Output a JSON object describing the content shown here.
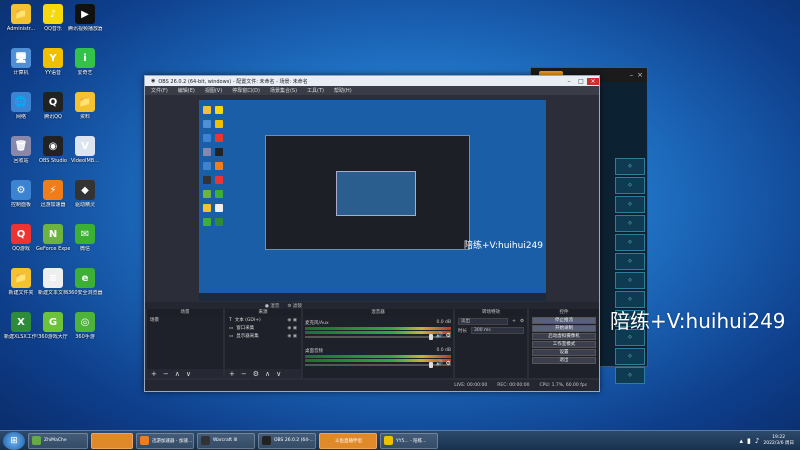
{
  "desktop_icons": [
    {
      "label": "Administr...",
      "color": "#f2c230",
      "glyph": "📁"
    },
    {
      "label": "QQ音乐",
      "color": "#f5d90a",
      "glyph": "♪"
    },
    {
      "label": "腾讯视频播放器",
      "color": "#111",
      "glyph": "▶"
    },
    {
      "label": "计算机",
      "color": "#4f8fd6",
      "glyph": "🖥"
    },
    {
      "label": "YY语音",
      "color": "#f0c000",
      "glyph": "Y"
    },
    {
      "label": "爱奇艺",
      "color": "#33c24a",
      "glyph": "i"
    },
    {
      "label": "网络",
      "color": "#3c83d2",
      "glyph": "🌐"
    },
    {
      "label": "腾讯QQ",
      "color": "#222",
      "glyph": "Q"
    },
    {
      "label": "资料",
      "color": "#f2c230",
      "glyph": "📁"
    },
    {
      "label": "回收站",
      "color": "#88a",
      "glyph": "🗑"
    },
    {
      "label": "OBS Studio",
      "color": "#222",
      "glyph": "◉"
    },
    {
      "label": "VideoIMB...",
      "color": "#dce4ef",
      "glyph": "V"
    },
    {
      "label": "控制面板",
      "color": "#3c83d2",
      "glyph": "⚙"
    },
    {
      "label": "迅游加速器",
      "color": "#f07c1a",
      "glyph": "⚡"
    },
    {
      "label": "驱动精灵",
      "color": "#333",
      "glyph": "◆"
    },
    {
      "label": "QQ游戏",
      "color": "#e33",
      "glyph": "Q"
    },
    {
      "label": "GeForce Experience",
      "color": "#6db33f",
      "glyph": "N"
    },
    {
      "label": "微信",
      "color": "#3cb034",
      "glyph": "✉"
    },
    {
      "label": "新建文件夹",
      "color": "#f2c230",
      "glyph": "📁"
    },
    {
      "label": "新建文本文档",
      "color": "#eee",
      "glyph": "≡"
    },
    {
      "label": "360安全浏览器",
      "color": "#3cb034",
      "glyph": "e"
    },
    {
      "label": "新建XLSX工作表",
      "color": "#2e8b3c",
      "glyph": "X"
    },
    {
      "label": "360游戏大厅",
      "color": "#6cc23a",
      "glyph": "G"
    },
    {
      "label": "360手游",
      "color": "#4db33a",
      "glyph": "◎"
    }
  ],
  "obs": {
    "title": "OBS 26.0.2 (64-bit, windows) - 配置文件: 未命名 - 场景: 未命名",
    "menu": [
      "文件(F)",
      "编辑(E)",
      "视图(V)",
      "停靠窗口(D)",
      "场景集合(S)",
      "工具(T)",
      "帮助(H)"
    ],
    "preview_watermark": "陪练+V:huihui249",
    "scene_bar": [
      "● 混音",
      "⚙ 滤镜"
    ],
    "docks": {
      "scenes_title": "场景",
      "sources_title": "来源",
      "mixer_title": "混音器",
      "transitions_title": "转场特效",
      "controls_title": "控件"
    },
    "scenes": [
      "场景"
    ],
    "sources": [
      {
        "icon": "T",
        "name": "文本 (GDI+)"
      },
      {
        "icon": "▭",
        "name": "窗口采集"
      },
      {
        "icon": "▭",
        "name": "显示器采集"
      }
    ],
    "mixer": [
      {
        "name": "麦克风/Aux",
        "db": "0.0 dB"
      },
      {
        "name": "桌面音频",
        "db": "0.0 dB"
      }
    ],
    "transition": {
      "type": "淡出",
      "duration_label": "时长",
      "duration": "300 ms"
    },
    "controls": [
      "停止推流",
      "开始录制",
      "启动虚拟摄像机",
      "工作室模式",
      "设置",
      "退出"
    ],
    "status": [
      "LIVE: 00:00:00",
      "REC: 00:00:00",
      "CPU: 1.7%, 60.00 fps"
    ]
  },
  "watermark": "陪练+V:huihui249",
  "taskbar": {
    "tasks": [
      {
        "label": "ZhiMaChe",
        "color": "#6a4"
      },
      {
        "label": "",
        "color": "#e0892a"
      },
      {
        "label": "迅游加速器 - 加速...",
        "color": "#f07c1a"
      },
      {
        "label": "Warcraft III",
        "color": "#333"
      },
      {
        "label": "OBS 26.0.2 (64-...",
        "color": "#222"
      },
      {
        "label": "斗鱼直播伴侣",
        "color": "#e0892a"
      },
      {
        "label": "YY5... - 陪练...",
        "color": "#f0c000"
      }
    ],
    "clock_time": "19:22",
    "clock_date": "2022/3/6 周日"
  }
}
